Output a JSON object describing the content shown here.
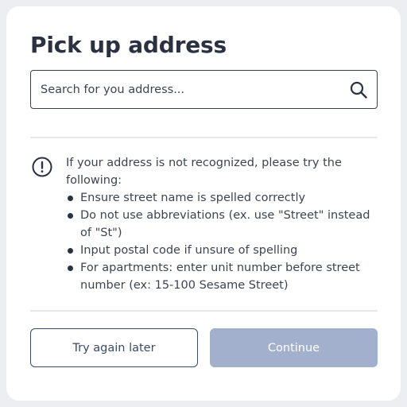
{
  "title": "Pick up address",
  "search": {
    "placeholder": "Search for you address...",
    "value": "",
    "icon": "search-icon"
  },
  "info": {
    "icon": "exclamation-circle-icon",
    "intro": "If your address is not recognized, please try the following:",
    "tips": [
      "Ensure street name is spelled correctly",
      "Do not use abbreviations (ex. use \"Street\" instead of \"St\")",
      "Input postal code if unsure of spelling",
      "For apartments: enter unit number before street number (ex: 15-100 Sesame Street)"
    ]
  },
  "buttons": {
    "secondary_label": "Try again later",
    "primary_label": "Continue",
    "primary_disabled": true
  },
  "colors": {
    "background": "#eceef2",
    "card": "#ffffff",
    "title_text": "#2b3140",
    "secondary_button_border": "#3b4a6b",
    "primary_button_disabled": "#a3b0cd"
  }
}
